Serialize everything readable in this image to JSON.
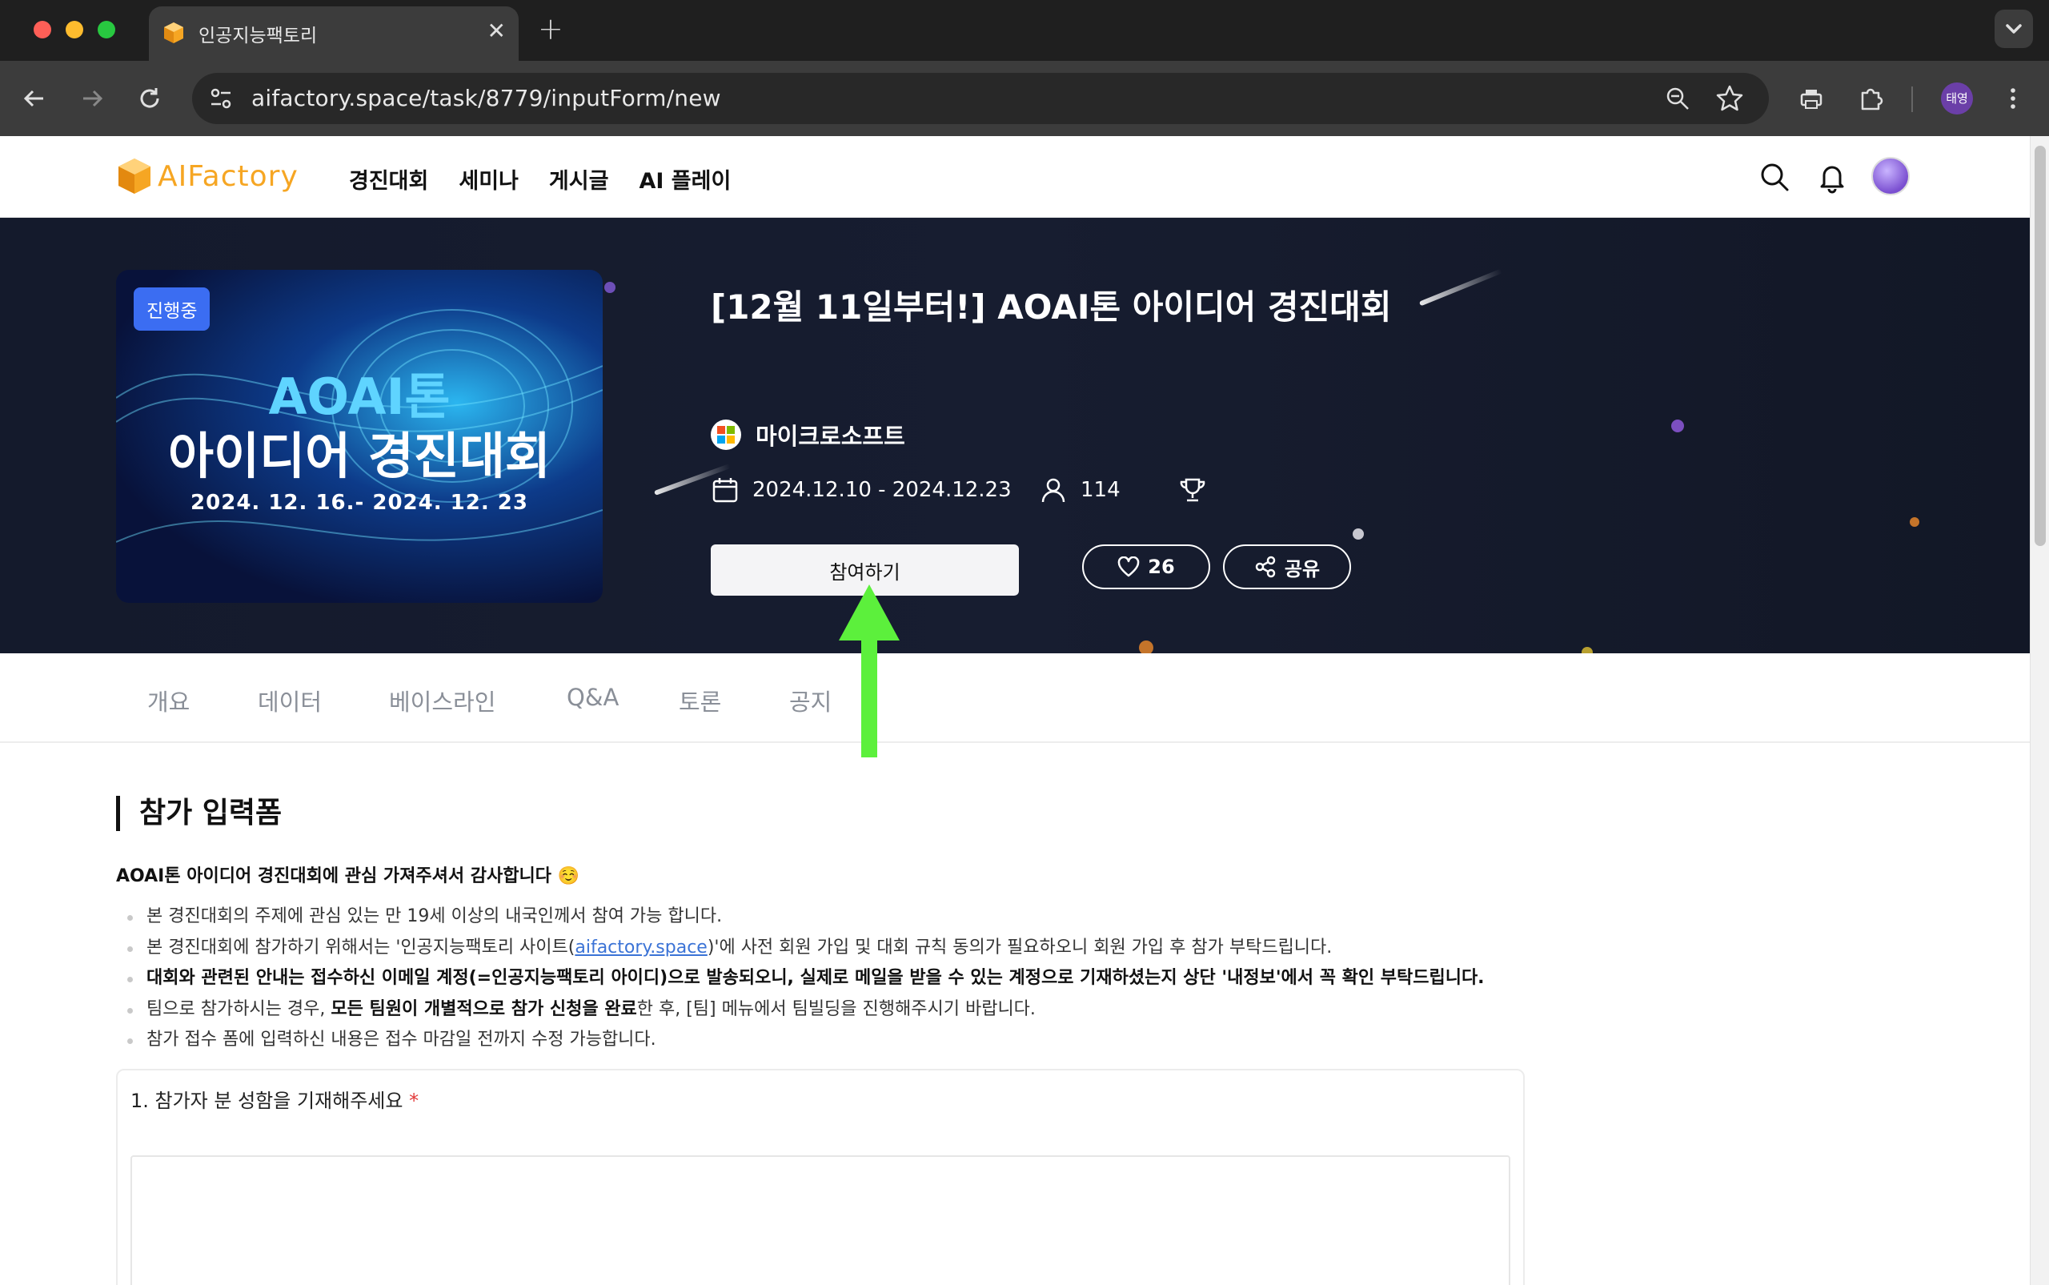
{
  "browser": {
    "tab_title": "인공지능팩토리",
    "tab_close": "✕",
    "new_tab": "+",
    "url": "aifactory.space/task/8779/inputForm/new",
    "profile_label": "태영"
  },
  "site": {
    "logo_text": "AIFactory",
    "nav": [
      "경진대회",
      "세미나",
      "게시글",
      "AI 플레이"
    ]
  },
  "hero": {
    "status_badge": "진행중",
    "poster_title_1": "AOAI톤",
    "poster_title_2": "아이디어 경진대회",
    "poster_dates": "2024. 12. 16.- 2024. 12. 23",
    "title": "[12월 11일부터!] AOAI톤 아이디어 경진대회",
    "host": "마이크로소프트",
    "period": "2024.12.10 - 2024.12.23",
    "participants": "114",
    "join_label": "참여하기",
    "likes": "26",
    "share_label": "공유"
  },
  "tabs": [
    "개요",
    "데이터",
    "베이스라인",
    "Q&A",
    "토론",
    "공지"
  ],
  "form": {
    "section_title": "참가 입력폼",
    "intro": "AOAI톤 아이디어 경진대회에 관심 가져주셔서 감사합니다 ☺️",
    "bullets": {
      "b1": "본 경진대회의 주제에 관심 있는 만 19세 이상의 내국인께서 참여 가능 합니다.",
      "b2_pre": "본 경진대회에 참가하기 위해서는 '인공지능팩토리 사이트(",
      "b2_link": "aifactory.space",
      "b2_post": ")'에 사전 회원 가입 및 대회 규칙 동의가 필요하오니 회원 가입 후 참가 부탁드립니다.",
      "b3": "대회와 관련된 안내는 접수하신 이메일 계정(=인공지능팩토리 아이디)으로 발송되오니, 실제로 메일을 받을 수 있는 계정으로 기재하셨는지 상단 '내정보'에서 꼭 확인 부탁드립니다.",
      "b4_pre": "팀으로 참가하시는 경우, ",
      "b4_bold": "모든 팀원이 개별적으로 참가 신청을 완료",
      "b4_post": "한 후, [팀] 메뉴에서 팀빌딩을 진행해주시기 바랍니다.",
      "b5": "참가 접수 폼에 입력하신 내용은 접수 마감일 전까지 수정 가능합니다."
    },
    "question_1": "1. 참가자 분 성함을 기재해주세요",
    "required_mark": "*",
    "answer_1": ""
  },
  "colors": {
    "brand": "#f6a623",
    "hero_bg": "#161c2e",
    "badge": "#3b6df2",
    "arrow": "#5cf03c",
    "link": "#3b73d6"
  }
}
